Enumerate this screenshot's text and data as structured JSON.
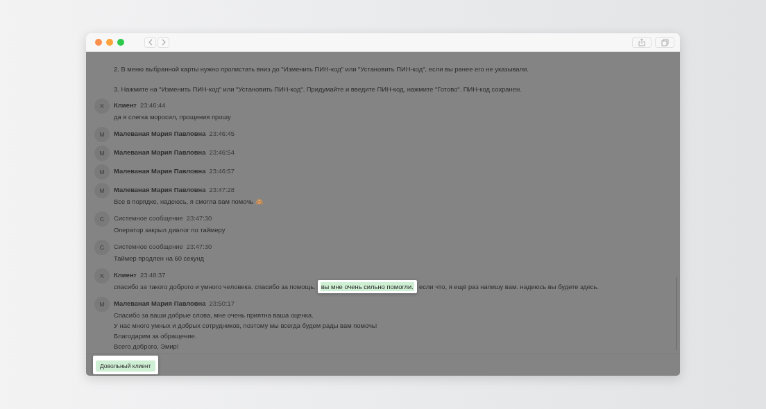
{
  "instructions": [
    "2. В меню выбранной карты нужно пролистать вниз до \"Изменить ПИН-код\" или \"Установить ПИН-код\", если вы ранее его не указывали.",
    "3. Нажмите на \"Изменить ПИН-код\" или \"Установить ПИН-код\". Придумайте и введите ПИН-код, нажмите \"Готово\". ПИН-код сохранен."
  ],
  "messages": [
    {
      "kind": "client",
      "avatar": "К",
      "author": "Клиент",
      "time": "23:46:44",
      "lines": [
        [
          {
            "text": "да я слегка моросил, прощения прошу",
            "highlighted": false
          }
        ]
      ]
    },
    {
      "kind": "operator",
      "avatar": "М",
      "author": "Малеваная Мария Павловна",
      "time": "23:46:45"
    },
    {
      "kind": "operator",
      "avatar": "М",
      "author": "Малеваная Мария Павловна",
      "time": "23:46:54"
    },
    {
      "kind": "operator",
      "avatar": "М",
      "author": "Малеваная Мария Павловна",
      "time": "23:46:57"
    },
    {
      "kind": "operator",
      "avatar": "М",
      "author": "Малеваная Мария Павловна",
      "time": "23:47:28",
      "lines": [
        [
          {
            "text": "Все в порядке, надеюсь, я смогла вам помочь 🙈",
            "highlighted": false
          }
        ]
      ]
    },
    {
      "kind": "system",
      "avatar": "С",
      "author": "Системное сообщение",
      "time": "23:47:30",
      "lines": [
        [
          {
            "text": "Оператор закрыл диалог по таймеру",
            "highlighted": false
          }
        ]
      ]
    },
    {
      "kind": "system",
      "avatar": "С",
      "author": "Системное сообщение",
      "time": "23:47:30",
      "lines": [
        [
          {
            "text": "Таймер продлен на 60 секунд",
            "highlighted": false
          }
        ]
      ]
    },
    {
      "kind": "client",
      "avatar": "К",
      "author": "Клиент",
      "time": "23:48:37",
      "lines": [
        [
          {
            "text": "спасибо за такого доброго и умного человека. спасибо за помощь.",
            "highlighted": false
          },
          {
            "text": "вы мне очень сильно помогли.",
            "highlighted": true
          },
          {
            "text": "если что, я ещё раз напишу вам. надеюсь вы будете здесь.",
            "highlighted": false
          }
        ]
      ]
    },
    {
      "kind": "operator",
      "avatar": "М",
      "author": "Малеваная Мария Павловна",
      "time": "23:50:17",
      "lines": [
        [
          {
            "text": "Спасибо за ваши добрые слова, мне очень приятна ваша оценка.",
            "highlighted": false
          }
        ],
        [
          {
            "text": "У нас много умных и добрых сотрудников, поэтому мы всегда будем рады вам помочь!",
            "highlighted": false
          }
        ],
        [
          {
            "text": "Благодарим за обращение.",
            "highlighted": false
          }
        ],
        [
          {
            "text": "Всего доброго, Эмир!",
            "highlighted": false
          }
        ]
      ]
    }
  ],
  "tags": [
    {
      "label": "Довольный клиент",
      "highlighted": true
    }
  ]
}
